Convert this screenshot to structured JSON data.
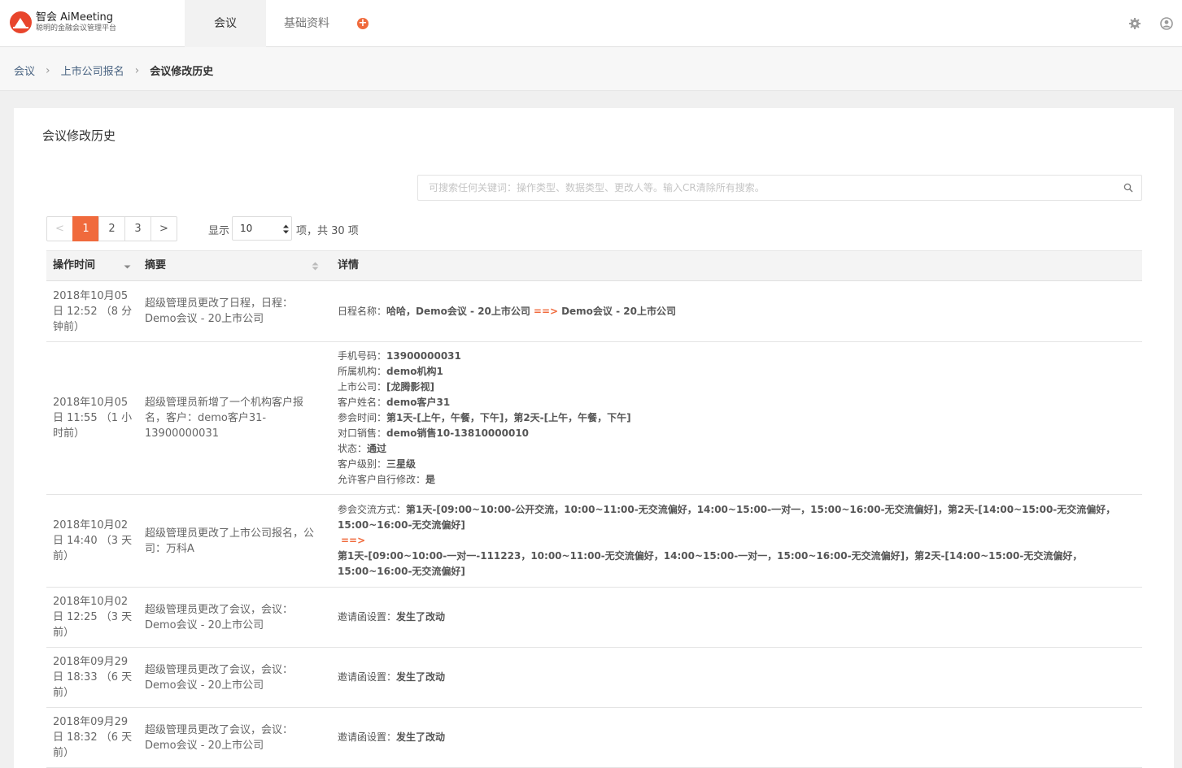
{
  "brand": {
    "name": "智会 AiMeeting",
    "subtitle": "聪明的金融会议管理平台"
  },
  "nav": {
    "tabs": [
      "会议",
      "基础资料"
    ],
    "add_icon": "plus-circle-icon"
  },
  "breadcrumb": [
    "会议",
    "上市公司报名",
    "会议修改历史"
  ],
  "page_title": "会议修改历史",
  "search": {
    "placeholder": "可搜索任何关键词：操作类型、数据类型、更改人等。输入CR清除所有搜索。"
  },
  "pagination": {
    "prev": "<",
    "pages": [
      "1",
      "2",
      "3"
    ],
    "current": "1",
    "next": ">"
  },
  "page_size": {
    "label": "显示",
    "value": "10",
    "summary": "项，共 30 项"
  },
  "table": {
    "headers": [
      "操作时间",
      "摘要",
      "详情"
    ],
    "rows": [
      {
        "time": "2018年10月05日 12:52 （8 分钟前）",
        "summary": "超级管理员更改了日程，日程：Demo会议 - 20上市公司",
        "detail_k": "日程名称：",
        "detail_old": "哈哈，Demo会议 - 20上市公司",
        "arrow": "==>",
        "detail_new": "Demo会议 - 20上市公司"
      },
      {
        "time": "2018年10月05日 11:55 （1 小时前）",
        "summary": "超级管理员新增了一个机构客户报名，客户：demo客户31-13900000031",
        "lines": [
          {
            "k": "手机号码：",
            "v": "13900000031"
          },
          {
            "k": "所属机构：",
            "v": "demo机构1"
          },
          {
            "k": "上市公司：",
            "v": "[龙腾影视]"
          },
          {
            "k": "客户姓名：",
            "v": "demo客户31"
          },
          {
            "k": "参会时间：",
            "v": "第1天-[上午，午餐，下午]，第2天-[上午，午餐，下午]"
          },
          {
            "k": "对口销售：",
            "v": "demo销售10-13810000010"
          },
          {
            "k": "状态：",
            "v": "通过"
          },
          {
            "k": "客户级别：",
            "v": "三星级"
          },
          {
            "k": "允许客户自行修改：",
            "v": "是"
          }
        ]
      },
      {
        "time": "2018年10月02日 14:40 （3 天前）",
        "summary": "超级管理员更改了上市公司报名，公司：万科A",
        "detail_k": "参会交流方式：",
        "detail_old": "第1天-[09:00~10:00-公开交流，10:00~11:00-无交流偏好，14:00~15:00-一对一，15:00~16:00-无交流偏好]，第2天-[14:00~15:00-无交流偏好，15:00~16:00-无交流偏好]",
        "arrow": "==>",
        "detail_new": "第1天-[09:00~10:00-一对一-111223，10:00~11:00-无交流偏好，14:00~15:00-一对一，15:00~16:00-无交流偏好]，第2天-[14:00~15:00-无交流偏好，15:00~16:00-无交流偏好]"
      },
      {
        "time": "2018年10月02日 12:25 （3 天前）",
        "summary": "超级管理员更改了会议，会议：Demo会议 - 20上市公司",
        "detail_k": "邀请函设置：",
        "detail_v": "发生了改动"
      },
      {
        "time": "2018年09月29日 18:33 （6 天前）",
        "summary": "超级管理员更改了会议，会议：Demo会议 - 20上市公司",
        "detail_k": "邀请函设置：",
        "detail_v": "发生了改动"
      },
      {
        "time": "2018年09月29日 18:32 （6 天前）",
        "summary": "超级管理员更改了会议，会议：Demo会议 - 20上市公司",
        "detail_k": "邀请函设置：",
        "detail_v": "发生了改动"
      }
    ]
  },
  "colors": {
    "accent": "#f06a3c",
    "logo": "#e8452c",
    "link": "#4a6482"
  }
}
